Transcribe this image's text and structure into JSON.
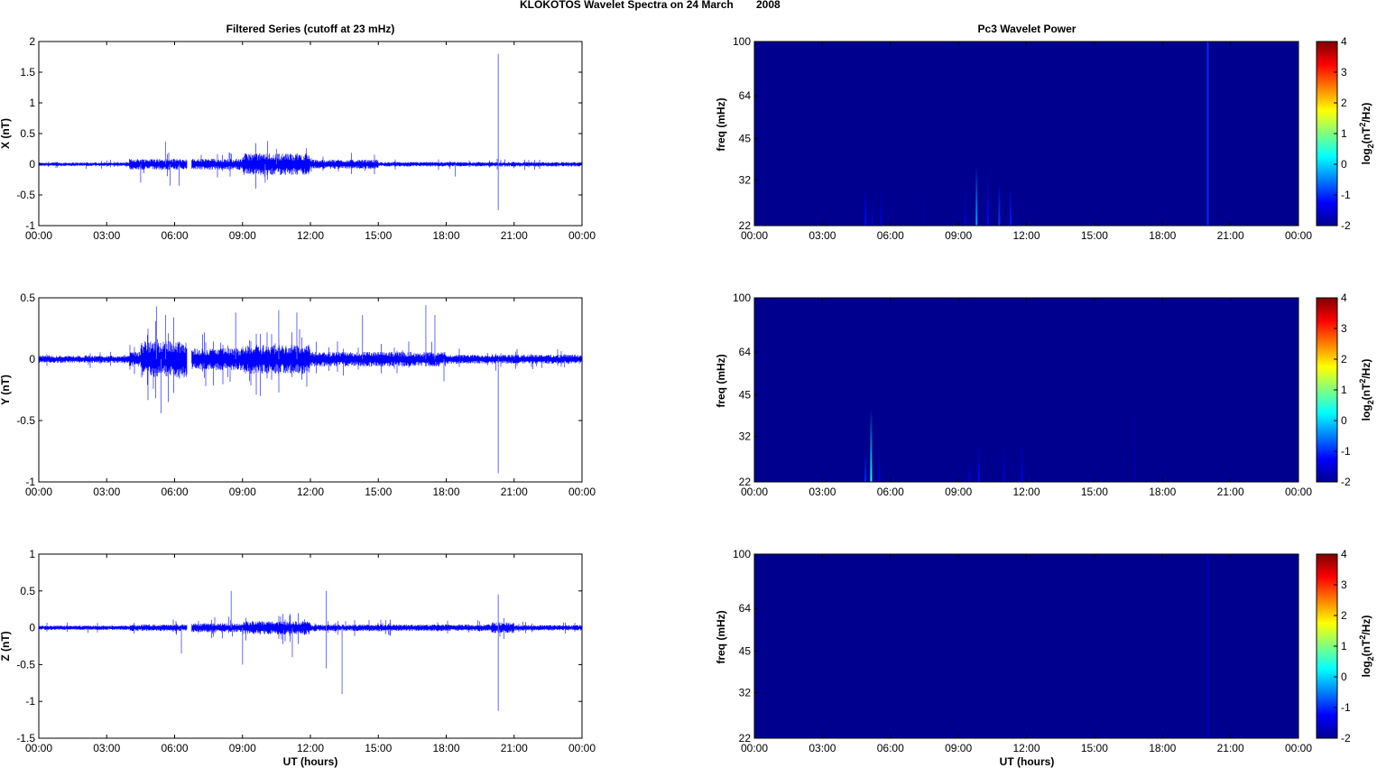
{
  "title_main": "KLOKOTOS Wavelet Spectra on 24 March",
  "title_year": "2008",
  "chart_data": {
    "type": "line",
    "time_ticks": [
      "00:00",
      "03:00",
      "06:00",
      "09:00",
      "12:00",
      "15:00",
      "18:00",
      "21:00",
      "00:00"
    ],
    "xlabel": "UT (hours)",
    "xlim": [
      0,
      24
    ],
    "data_gap_hours": [
      6.55,
      6.75
    ],
    "left_title": "Filtered Series (cutoff at 23 mHz)",
    "right_title": "Pc3 Wavelet Power",
    "series": [
      {
        "name": "X",
        "ylabel": "X (nT)",
        "ylim": [
          -1,
          2
        ],
        "yticks": [
          "2",
          "1.5",
          "1",
          "0.5",
          "0",
          "-0.5",
          "-1"
        ],
        "envelope": [
          [
            0,
            4,
            0.02
          ],
          [
            4,
            6.55,
            0.06
          ],
          [
            6.75,
            9,
            0.06
          ],
          [
            9,
            12,
            0.12
          ],
          [
            12,
            15,
            0.05
          ],
          [
            15,
            24,
            0.025
          ]
        ],
        "spikes": [
          [
            4.5,
            -0.3
          ],
          [
            5.6,
            0.37
          ],
          [
            5.8,
            -0.35
          ],
          [
            6.2,
            -0.35
          ],
          [
            10.0,
            -0.3
          ],
          [
            10.5,
            0.25
          ],
          [
            18.4,
            -0.2
          ],
          [
            20.3,
            1.8
          ],
          [
            20.3,
            -0.75
          ]
        ]
      },
      {
        "name": "Y",
        "ylabel": "Y (nT)",
        "ylim": [
          -1,
          0.5
        ],
        "yticks": [
          "0.5",
          "0",
          "-0.5",
          "-1"
        ],
        "envelope": [
          [
            0,
            4,
            0.02
          ],
          [
            4,
            4.5,
            0.04
          ],
          [
            4.5,
            6.55,
            0.1
          ],
          [
            6.75,
            9,
            0.06
          ],
          [
            9,
            12,
            0.08
          ],
          [
            12,
            18,
            0.04
          ],
          [
            18,
            24,
            0.025
          ]
        ],
        "spikes": [
          [
            5.2,
            0.43
          ],
          [
            5.4,
            -0.44
          ],
          [
            5.6,
            0.36
          ],
          [
            8.7,
            0.38
          ],
          [
            10.6,
            0.4
          ],
          [
            11.4,
            0.38
          ],
          [
            14.3,
            0.36
          ],
          [
            17.1,
            0.44
          ],
          [
            17.5,
            0.36
          ],
          [
            17.9,
            -0.18
          ],
          [
            20.3,
            -0.93
          ]
        ]
      },
      {
        "name": "Z",
        "ylabel": "Z (nT)",
        "ylim": [
          -1.5,
          1
        ],
        "yticks": [
          "1",
          "0.5",
          "0",
          "-0.5",
          "-1",
          "-1.5"
        ],
        "envelope": [
          [
            0,
            4,
            0.02
          ],
          [
            4,
            6.55,
            0.03
          ],
          [
            6.75,
            9,
            0.04
          ],
          [
            9,
            12,
            0.06
          ],
          [
            12,
            20,
            0.03
          ],
          [
            20,
            21,
            0.05
          ],
          [
            21,
            24,
            0.025
          ]
        ],
        "spikes": [
          [
            6.3,
            -0.35
          ],
          [
            8.5,
            0.5
          ],
          [
            9.0,
            -0.5
          ],
          [
            11.2,
            -0.4
          ],
          [
            12.7,
            0.5
          ],
          [
            12.7,
            -0.55
          ],
          [
            13.4,
            -0.9
          ],
          [
            20.3,
            0.45
          ],
          [
            20.3,
            -1.13
          ]
        ]
      }
    ],
    "spectra": [
      {
        "name": "X",
        "ylabel": "freq (mHz)",
        "yticks": [
          "100",
          "64",
          "45",
          "32",
          "22"
        ],
        "ylim_mHz": [
          22,
          100
        ],
        "events": [
          [
            4.9,
            30,
            -1.2
          ],
          [
            5.2,
            27,
            -1.5
          ],
          [
            5.6,
            29,
            -1.4
          ],
          [
            7.5,
            27,
            -1.7
          ],
          [
            9.3,
            30,
            -1.5
          ],
          [
            9.8,
            36,
            -0.3
          ],
          [
            10.3,
            33,
            -1.2
          ],
          [
            10.8,
            31,
            -0.9
          ],
          [
            11.3,
            30,
            -1.1
          ],
          [
            20.0,
            100,
            -1.0
          ]
        ]
      },
      {
        "name": "Y",
        "ylabel": "freq (mHz)",
        "yticks": [
          "100",
          "64",
          "45",
          "32",
          "22"
        ],
        "ylim_mHz": [
          22,
          100
        ],
        "events": [
          [
            4.9,
            28,
            -1.0
          ],
          [
            5.15,
            40,
            0.4
          ],
          [
            5.5,
            30,
            -1.5
          ],
          [
            9.5,
            26,
            -1.4
          ],
          [
            9.9,
            30,
            -1.2
          ],
          [
            11.0,
            30,
            -1.5
          ],
          [
            11.8,
            30,
            -1.3
          ],
          [
            16.8,
            40,
            -1.7
          ]
        ]
      },
      {
        "name": "Z",
        "ylabel": "freq (mHz)",
        "yticks": [
          "100",
          "64",
          "45",
          "32",
          "22"
        ],
        "ylim_mHz": [
          22,
          100
        ],
        "events": [
          [
            20.0,
            100,
            -1.6
          ]
        ]
      }
    ],
    "colorbar": {
      "range": [
        -2,
        4
      ],
      "ticks": [
        "4",
        "3",
        "2",
        "1",
        "0",
        "-1",
        "-2"
      ],
      "label_parts": [
        "log",
        "2",
        "(nT",
        "2",
        "/Hz)"
      ]
    },
    "colors": {
      "series": "#0000ff",
      "spectrum_background": "#00008f"
    }
  }
}
